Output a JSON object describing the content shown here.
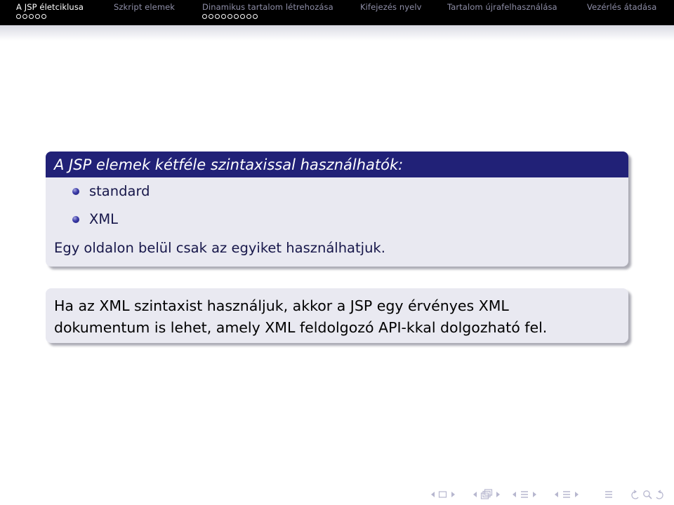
{
  "nav": {
    "sections": [
      {
        "label": "A JSP életciklusa",
        "active": true,
        "dots": 5
      },
      {
        "label": "Szkript elemek",
        "active": false,
        "dots": 0
      },
      {
        "label": "Dinamikus tartalom létrehozása",
        "active": false,
        "dots": 9
      },
      {
        "label": "Kifejezés nyelv",
        "active": false,
        "dots": 0
      },
      {
        "label": "Tartalom újrafelhasználása",
        "active": false,
        "dots": 0
      },
      {
        "label": "Vezérlés átadása",
        "active": false,
        "dots": 0
      }
    ]
  },
  "block1": {
    "title": "A JSP elemek kétféle szintaxissal használhatók:",
    "items": [
      "standard",
      "XML"
    ],
    "note": "Egy oldalon belül csak az egyiket használhatjuk."
  },
  "block2": {
    "lines": [
      "Ha az XML szintaxist használjuk, akkor a JSP egy érvényes XML",
      "dokumentum is lehet, amely XML feldolgozó API-kkal dolgozható fel."
    ]
  },
  "colors": {
    "navbar_bg": "#000000",
    "block_title_bg": "#212177",
    "block_body_bg": "#e9e9f1",
    "text_blue": "#17174a"
  },
  "nav_symbols": [
    "slide-prev-icon",
    "slide-next-icon",
    "frame-prev-icon",
    "frame-next-icon",
    "subsection-prev-icon",
    "subsection-next-icon",
    "section-prev-icon",
    "section-next-icon",
    "toc-icon",
    "search-back-icon",
    "search-icon",
    "search-forward-icon"
  ]
}
